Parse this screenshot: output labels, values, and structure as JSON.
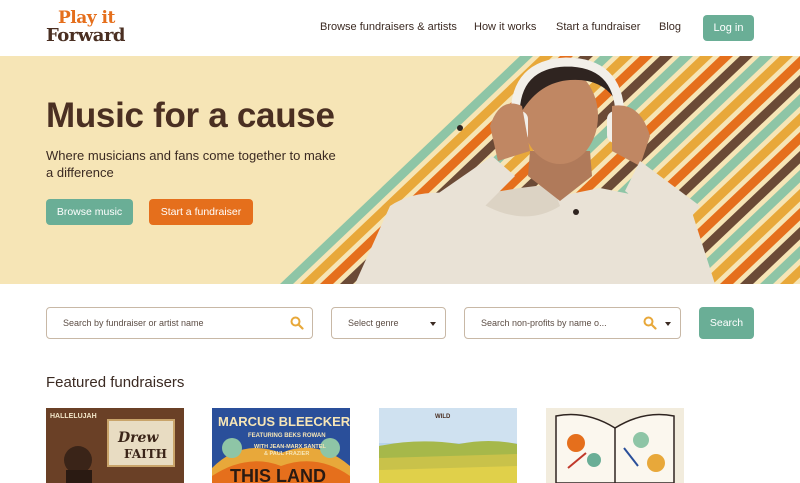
{
  "header": {
    "logo_line1": "Play it",
    "logo_line2": "Forward",
    "nav": [
      {
        "label": "Browse fundraisers & artists"
      },
      {
        "label": "How it works"
      },
      {
        "label": "Start a fundraiser"
      },
      {
        "label": "Blog"
      }
    ],
    "login_label": "Log in"
  },
  "hero": {
    "title": "Music for a cause",
    "subtitle": "Where musicians and fans come together to make a difference",
    "browse_label": "Browse music",
    "start_label": "Start a fundraiser",
    "stripe_colors": [
      "#8ec5a6",
      "#e8a83a",
      "#e56f1c",
      "#6b4a36"
    ]
  },
  "search": {
    "fundraiser_placeholder": "Search by fundraiser or artist name",
    "genre_placeholder": "Select genre",
    "nonprofit_placeholder": "Search non-profits by name o...",
    "button_label": "Search"
  },
  "featured": {
    "title": "Featured fundraisers",
    "cards": [
      {
        "top_text": "HALLELUJAH",
        "main_text": "Drew",
        "sub_text": "FAITH"
      },
      {
        "top_text": "MARCUS BLEECKER",
        "sub_text": "FEATURING BEKS ROWAN",
        "sub_text2": "WITH JEAN-MARX SANTEL",
        "sub_text3": "& PAUL FRAZIER",
        "main_text": "THIS LAND"
      },
      {
        "top_text": "WILD",
        "main_text": ""
      },
      {
        "top_text": "",
        "main_text": ""
      }
    ]
  },
  "colors": {
    "brand_orange": "#e56f1c",
    "brand_green": "#6aae96",
    "brand_brown": "#4a2f22",
    "hero_bg": "#f6e5b6"
  }
}
